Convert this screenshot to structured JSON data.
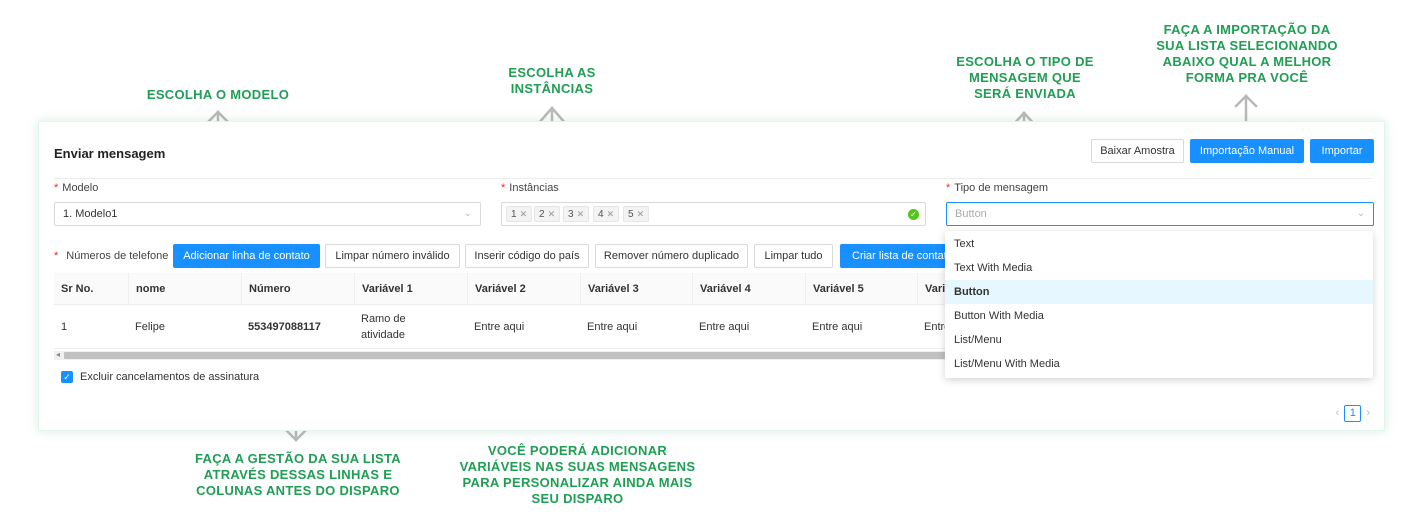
{
  "annotations": {
    "modelo": [
      "ESCOLHA O MODELO"
    ],
    "instancias": [
      "ESCOLHA AS",
      "INSTÂNCIAS"
    ],
    "tipo": [
      "ESCOLHA O TIPO DE",
      "MENSAGEM QUE",
      "SERÁ ENVIADA"
    ],
    "importacao": [
      "FAÇA A IMPORTAÇÃO DA",
      "SUA LISTA SELECIONANDO",
      "ABAIXO QUAL A MELHOR",
      "FORMA PRA VOCÊ"
    ],
    "gestao": [
      "FAÇA A GESTÃO DA SUA LISTA",
      "ATRAVÉS DESSAS LINHAS E",
      "COLUNAS ANTES DO DISPARO"
    ],
    "variaveis": [
      "VOCÊ PODERÁ ADICIONAR",
      "VARIÁVEIS NAS SUAS MENSAGENS",
      "PARA PERSONALIZAR AINDA MAIS",
      "SEU DISPARO"
    ]
  },
  "header": {
    "title": "Enviar mensagem",
    "btn_baixar": "Baixar Amostra",
    "btn_importacao_manual": "Importação Manual",
    "btn_importar": "Importar"
  },
  "form": {
    "modelo_label": "Modelo",
    "modelo_value": "1. Modelo1",
    "instancias_label": "Instâncias",
    "instancias_tags": [
      "1",
      "2",
      "3",
      "4",
      "5"
    ],
    "tipo_label": "Tipo de mensagem",
    "tipo_placeholder": "Button"
  },
  "toolbar": {
    "phones_label": "Números de telefone",
    "add_row": "Adicionar linha de contato",
    "clear_invalid": "Limpar número inválido",
    "insert_code": "Inserir código do país",
    "remove_dup": "Remover número duplicado",
    "clear_all": "Limpar tudo",
    "create_list": "Criar lista de contato"
  },
  "table": {
    "columns": [
      "Sr No.",
      "nome",
      "Número",
      "Variável 1",
      "Variável 2",
      "Variável 3",
      "Variável 4",
      "Variável 5",
      "Variá"
    ],
    "rows": [
      [
        "1",
        "Felipe",
        "553497088117",
        "Ramo de atividade",
        "Entre aqui",
        "Entre aqui",
        "Entre aqui",
        "Entre aqui",
        "Entre"
      ]
    ]
  },
  "options": {
    "exclude_label": "Excluir cancelamentos de assinatura"
  },
  "pagination": {
    "current": "1",
    "prev": "‹",
    "next": "›"
  },
  "dropdown": {
    "items": [
      "Text",
      "Text With Media",
      "Button",
      "Button With Media",
      "List/Menu",
      "List/Menu With Media"
    ],
    "selected_index": 2
  },
  "colors": {
    "accent": "#1890ff",
    "annotation": "#1f9e54",
    "required": "#f5222d",
    "success": "#52c41a"
  }
}
